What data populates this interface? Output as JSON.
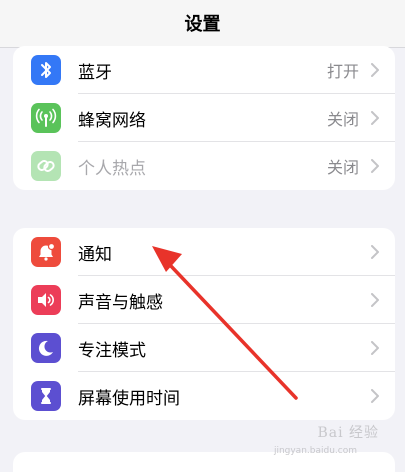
{
  "header": {
    "title": "设置"
  },
  "group1": {
    "items": [
      {
        "label": "蓝牙",
        "value": "打开",
        "icon": "bluetooth-icon",
        "color": "#3478f6"
      },
      {
        "label": "蜂窝网络",
        "value": "关闭",
        "icon": "cellular-antenna-icon",
        "color": "#5ac35a"
      },
      {
        "label": "个人热点",
        "value": "关闭",
        "icon": "hotspot-link-icon",
        "color": "#5ac35a"
      }
    ]
  },
  "group2": {
    "items": [
      {
        "label": "通知",
        "icon": "notification-bell-icon",
        "color": "#ee4b3c"
      },
      {
        "label": "声音与触感",
        "icon": "speaker-icon",
        "color": "#ec3d58"
      },
      {
        "label": "专注模式",
        "icon": "moon-icon",
        "color": "#5c4fd1"
      },
      {
        "label": "屏幕使用时间",
        "icon": "hourglass-icon",
        "color": "#5c4fd1"
      }
    ]
  },
  "annotation": {
    "arrow_color": "#e8332a"
  },
  "watermark": {
    "text": "Bai 经验",
    "sub": "jingyan.baidu.com"
  }
}
